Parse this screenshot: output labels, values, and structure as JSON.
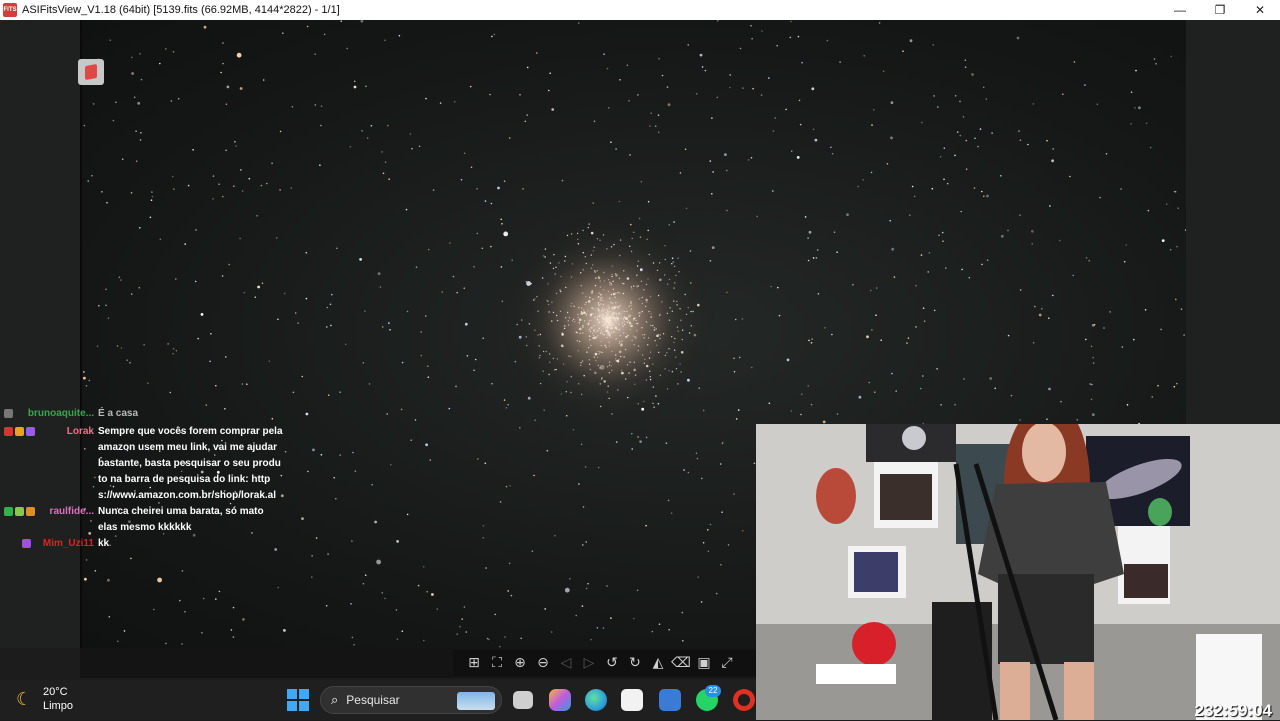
{
  "window": {
    "app_icon": "fits-icon",
    "title": "ASIFitsView_V1.18 (64bit) [5139.fits (66.92MB, 4144*2822) - 1/1]",
    "minimize": "—",
    "maximize": "❐",
    "close": "✕"
  },
  "viewer": {
    "image": "globular cluster star field"
  },
  "toolbar": {
    "icons": [
      "fit-icon",
      "crop-icon",
      "zoom-in-icon",
      "zoom-out-icon",
      "prev-icon",
      "next-icon",
      "rotate-left-icon",
      "rotate-right-icon",
      "histogram-icon",
      "delete-icon",
      "save-icon",
      "fullscreen-icon"
    ],
    "glyphs": [
      "⊞",
      "⛶",
      "⊕",
      "⊖",
      "◁",
      "▷",
      "↺",
      "↻",
      "◭",
      "🗑",
      "▣",
      "⤢"
    ]
  },
  "chat": {
    "messages": [
      {
        "user": "brunoaquite...",
        "user_color": "#3aa64a",
        "text": "É a casa",
        "text_color": "#b8b8b8",
        "badges": [
          "#777777"
        ]
      },
      {
        "user": "Lorak",
        "user_color": "#ff6a8a",
        "text": "Sempre que vocês forem comprar pela amazon usem meu link, vai me ajudar bastante, basta pesquisar o seu produto na barra de pesquisa do link: https://www.amazon.com.br/shop/lorak.al",
        "text_color": "#ffffff",
        "badges": [
          "#e03030",
          "#f0a020",
          "#9b59f0"
        ]
      },
      {
        "user": "raulfide...",
        "user_color": "#e070c0",
        "text": "Nunca cheirei uma barata, só mato elas mesmo kkkkkk",
        "text_color": "#ffffff",
        "badges": [
          "#2fb34a",
          "#8ac84a",
          "#e09020"
        ]
      },
      {
        "user": "Mim_Uzi11",
        "user_color": "#e02020",
        "text": "kk",
        "text_color": "#ffffff",
        "badges": [
          "#a050e0"
        ]
      }
    ]
  },
  "webcam": {
    "label": "webcam-overlay"
  },
  "taskbar": {
    "weather_temp": "20°C",
    "weather_condition": "Limpo",
    "weather_icon": "moon-icon",
    "search_placeholder": "Pesquisar",
    "whatsapp_badge": "22",
    "apps": [
      "task-view-icon",
      "copilot-icon",
      "edge-icon",
      "store-icon",
      "app-icon",
      "whatsapp-icon",
      "opera-icon"
    ],
    "colors": {
      "task_view": "#cfcfcf",
      "copilot": "#c05ae0",
      "edge": "#2fa0d8",
      "store": "#f2f2f2",
      "app": "#3a7bd5",
      "whatsapp": "#25d366",
      "opera": "#e03020"
    }
  },
  "stream": {
    "uptime": "232:59:04"
  }
}
